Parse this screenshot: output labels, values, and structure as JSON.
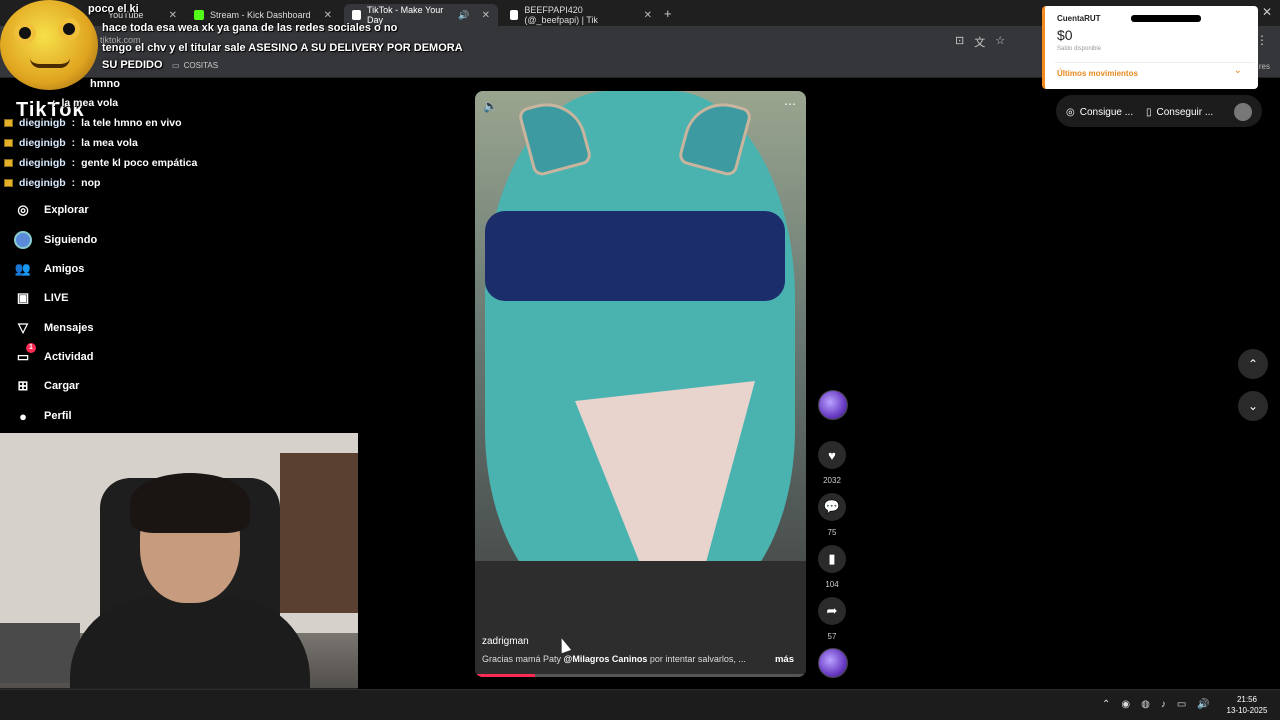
{
  "browser": {
    "tabs": [
      {
        "label": "YouTube",
        "favicon_color": "#ff0000",
        "active": false
      },
      {
        "label": "Stream - Kick Dashboard",
        "favicon_color": "#53fc18",
        "active": false
      },
      {
        "label": "TikTok - Make Your Day",
        "favicon_color": "#ffffff",
        "active": true
      },
      {
        "label": "BEEFPAPI420 (@_beefpapi) | Tik",
        "favicon_color": "#ffffff",
        "active": false
      }
    ],
    "url": "tiktok.com",
    "bookmark": "COSITAS",
    "bookmark_right": "res"
  },
  "chat": {
    "top_lines": [
      "poco el ki",
      "hace toda esa wea xk ya gana de las redes sociales o no",
      "tengo el chv y el titular sale ASESINO A SU DELIVERY POR DEMORA",
      "SU PEDIDO",
      "hmno"
    ],
    "messages": [
      {
        "user": "",
        "text": "la mea vola"
      },
      {
        "user": "dieginigb",
        "text": "la tele hmno en vivo"
      },
      {
        "user": "dieginigb",
        "text": "la mea vola"
      },
      {
        "user": "dieginigb",
        "text": "gente kl poco empática"
      },
      {
        "user": "dieginigb",
        "text": "nop"
      }
    ],
    "separator": ":"
  },
  "tiktok": {
    "logo": "TikTok",
    "sidebar": [
      {
        "label": "Explorar",
        "icon": "compass-icon",
        "glyph": "◎"
      },
      {
        "label": "Siguiendo",
        "icon": "following-avatar-icon",
        "glyph": ""
      },
      {
        "label": "Amigos",
        "icon": "friends-icon",
        "glyph": "👥"
      },
      {
        "label": "LIVE",
        "icon": "live-icon",
        "glyph": "▣"
      },
      {
        "label": "Mensajes",
        "icon": "messages-icon",
        "glyph": "▽"
      },
      {
        "label": "Actividad",
        "icon": "activity-icon",
        "glyph": "▭",
        "badge": "1"
      },
      {
        "label": "Cargar",
        "icon": "upload-icon",
        "glyph": "⊞"
      },
      {
        "label": "Perfil",
        "icon": "profile-icon",
        "glyph": "●"
      }
    ],
    "header": {
      "coins_label": "Consigue ...",
      "app_label": "Conseguir ..."
    },
    "video": {
      "author": "zadrigman",
      "caption_prefix": "Gracias mamá Paty",
      "caption_mention": "@Milagros Caninos",
      "caption_suffix": "por intentar salvarlos, ...",
      "more_label": "más",
      "progress": 0.18
    },
    "actions": {
      "likes": "2032",
      "comments": "75",
      "saves": "104",
      "shares": "57"
    }
  },
  "bank_popup": {
    "title": "CuentaRUT",
    "amount": "$0",
    "subtitle": "Saldo disponible",
    "link": "Últimos movimientos"
  },
  "taskbar": {
    "time": "21:56",
    "date": "13-10-2025"
  }
}
